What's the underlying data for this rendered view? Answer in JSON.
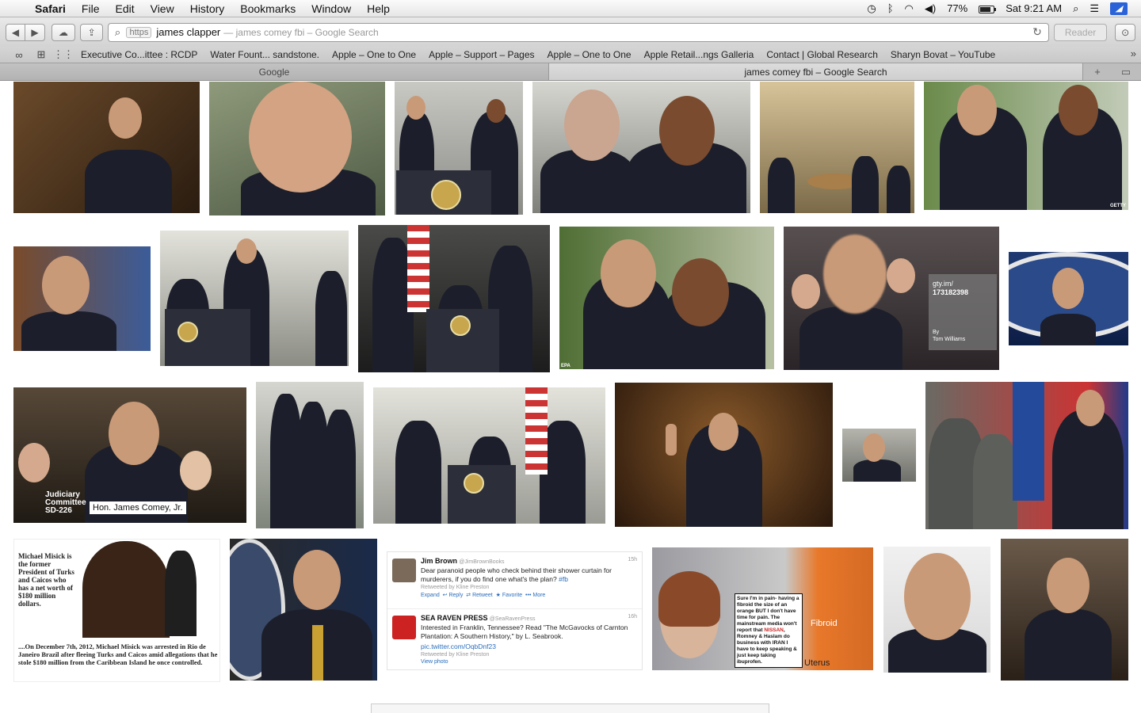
{
  "menubar": {
    "app_name": "Safari",
    "items": [
      "File",
      "Edit",
      "View",
      "History",
      "Bookmarks",
      "Window",
      "Help"
    ],
    "battery_percent": "77%",
    "clock": "Sat 9:21 AM"
  },
  "toolbar": {
    "address_scheme": "https",
    "address_query": "james clapper",
    "address_suggestion": "— james comey fbi – Google Search",
    "reader_label": "Reader"
  },
  "bookmarks": [
    "Executive Co...ittee : RCDP",
    "Water Fount... sandstone.",
    "Apple – One to One",
    "Apple – Support – Pages",
    "Apple – One to One",
    "Apple Retail...ngs Galleria",
    "Contact | Global Research",
    "Sharyn Bovat – YouTube"
  ],
  "tabs": [
    {
      "label": "Google",
      "active": false
    },
    {
      "label": "james comey fbi – Google Search",
      "active": true
    }
  ],
  "image_overlays": {
    "getty_mark": "GETTY",
    "gty_link": "gty.im/",
    "gty_id": "173182398",
    "by": "By",
    "photographer": "Tom Williams",
    "epa_mark": "EPA",
    "judiciary_1": "Judiciary",
    "judiciary_2": "Committee",
    "judiciary_3": "SD-226",
    "nameplate": "Hon. James Comey, Jr."
  },
  "misick": {
    "left_text": "Michael Misick is the former President of Turks and Caicos who has a net worth of $180 million dollars.",
    "bottom_text": "....On December 7th, 2012, Michael Misick was arrested in Rio de Janeiro Brazil after fleeing Turks and Caicos amid allegations that he stole $180 million from the Caribbean Island he once controlled."
  },
  "tweets": [
    {
      "name": "Jim Brown",
      "handle": "@JimBrownBooks",
      "time": "15h",
      "body": "Dear paranoid people who check behind their shower curtain for murderers, if you do find one what's the plan?",
      "tag": "#fb",
      "retweeted": "Retweeted by Kline Preston",
      "actions": [
        "Expand",
        "Reply",
        "Retweet",
        "Favorite",
        "More"
      ]
    },
    {
      "name": "SEA RAVEN PRESS",
      "handle": "@SeaRavenPress",
      "time": "16h",
      "body": "Interested in Franklin, Tennessee? Read \"The McGavocks of Carnton Plantation: A Southern History,\" by L. Seabrook.",
      "link": "pic.twitter.com/OqbDnf23",
      "retweeted": "Retweeted by Kline Preston",
      "view_photo": "View photo"
    }
  ],
  "fibroid": {
    "text_a": "Sure I'm in pain- having a fibroid the size of an orange BUT I don't have time for pain. The mainstream media won't report that ",
    "nissan": "NISSAN",
    "text_b": ", Romney & Haslam do business with IRAN I have to keep speaking & just keep taking ibuprofen.",
    "label_fibroid": "Fibroid",
    "label_uterus": "Uterus"
  },
  "colors": {
    "menubar_bg": "#ececec",
    "link_blue": "#2a6ebb",
    "nissan_red": "#cc2222",
    "notif_blue": "#2a62d8"
  }
}
